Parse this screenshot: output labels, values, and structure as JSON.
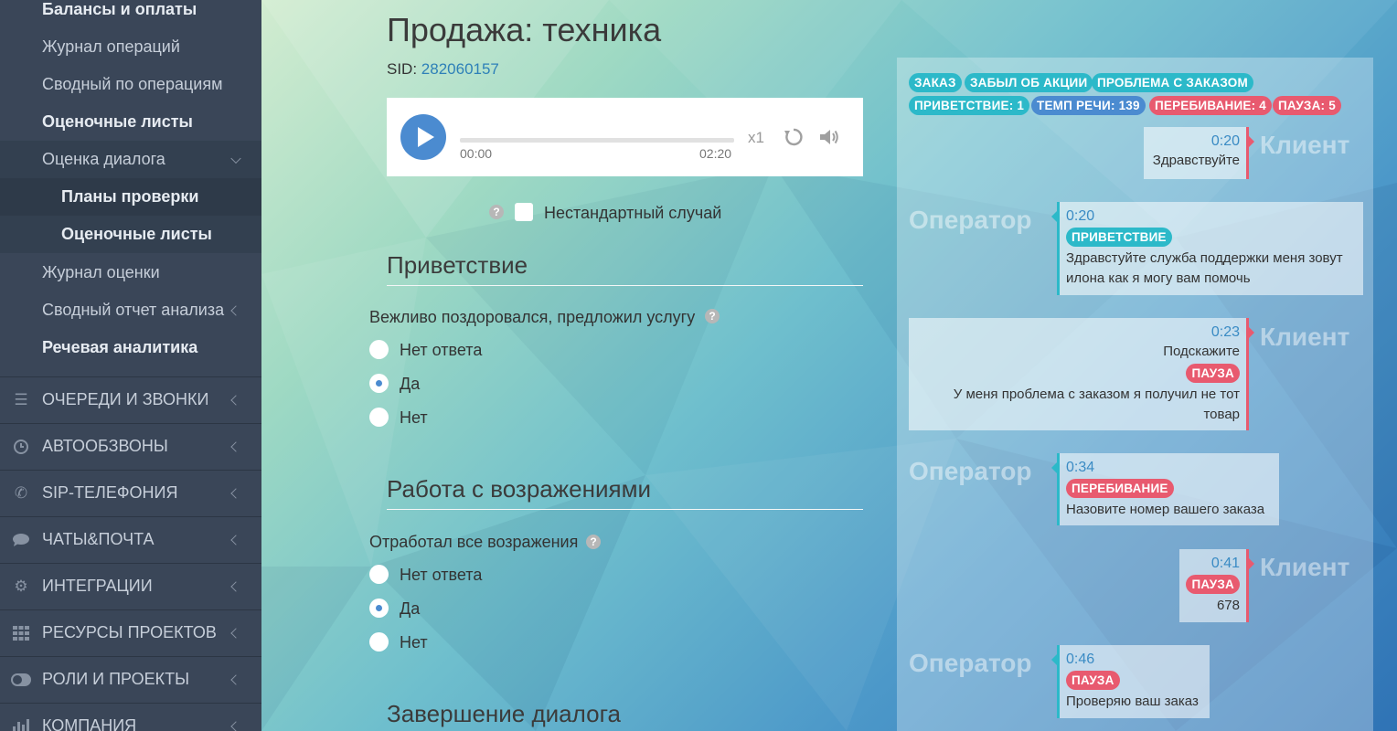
{
  "sidebar": {
    "items": [
      {
        "label": "Балансы и оплаты"
      },
      {
        "label": "Журнал операций"
      },
      {
        "label": "Сводный по операциям"
      },
      {
        "label": "Оценочные листы"
      },
      {
        "label": "Оценка диалога"
      },
      {
        "label": "Планы проверки"
      },
      {
        "label": "Оценочные листы"
      },
      {
        "label": "Журнал оценки"
      },
      {
        "label": "Сводный отчет анализа"
      },
      {
        "label": "Речевая аналитика"
      }
    ],
    "sections": [
      {
        "label": "ОЧЕРЕДИ И ЗВОНКИ",
        "icon": "list-icon"
      },
      {
        "label": "АВТООБЗВОНЫ",
        "icon": "clock-icon"
      },
      {
        "label": "SIP-ТЕЛЕФОНИЯ",
        "icon": "phone-icon"
      },
      {
        "label": "ЧАТЫ&ПОЧТА",
        "icon": "chat-icon"
      },
      {
        "label": "ИНТЕГРАЦИИ",
        "icon": "gears-icon"
      },
      {
        "label": "РЕСУРСЫ ПРОЕКТОВ",
        "icon": "grid-icon"
      },
      {
        "label": "РОЛИ И ПРОЕКТЫ",
        "icon": "toggle-icon"
      },
      {
        "label": "КОМПАНИЯ",
        "icon": "bar-chart-icon"
      }
    ]
  },
  "main": {
    "title": "Продажа: техника",
    "sid_label": "SID:",
    "sid_value": "282060157",
    "player": {
      "current": "00:00",
      "duration": "02:20",
      "speed": "x1",
      "progress": 0
    },
    "nonstandard_label": "Нестандартный случай",
    "sections": [
      {
        "title": "Приветствие",
        "question": "Вежливо поздоровался, предложил услугу",
        "options": [
          "Нет ответа",
          "Да",
          "Нет"
        ],
        "selected": 1
      },
      {
        "title": "Работа с возражениями",
        "question": "Отработал все возражения",
        "options": [
          "Нет ответа",
          "Да",
          "Нет"
        ],
        "selected": 1
      },
      {
        "title": "Завершение диалога"
      }
    ]
  },
  "panel": {
    "tags": [
      {
        "label": "ЗАКАЗ",
        "color": "#2cb9c9"
      },
      {
        "label": "ЗАБЫЛ ОБ АКЦИИ",
        "color": "#2cb9c9"
      },
      {
        "label": "ПРОБЛЕМА С ЗАКАЗОМ",
        "color": "#2cb9c9"
      },
      {
        "label": "ПРИВЕТСТВИЕ: 1",
        "color": "#2cb9c9"
      },
      {
        "label": "ТЕМП РЕЧИ: 139",
        "color": "#4b8bd0"
      },
      {
        "label": "ПЕРЕБИВАНИЕ: 4",
        "color": "#e85a6f"
      },
      {
        "label": "ПАУЗА: 5",
        "color": "#e85a6f"
      }
    ],
    "speakers": {
      "operator": "Оператор",
      "client": "Клиент"
    },
    "messages": [
      {
        "role": "client",
        "time": "0:20",
        "lines": [
          "Здравствуйте"
        ]
      },
      {
        "role": "operator",
        "time": "0:20",
        "tag": "ПРИВЕТСТВИЕ",
        "lines": [
          "Здравстуйте служба поддержки меня зовут",
          "илона как я могу вам помочь"
        ]
      },
      {
        "role": "client",
        "time": "0:23",
        "pre": "Подскажите",
        "tag": "ПАУЗА",
        "lines": [
          "У меня проблема с заказом я получил не тот",
          "товар"
        ]
      },
      {
        "role": "operator",
        "time": "0:34",
        "tag": "ПЕРЕБИВАНИЕ",
        "lines": [
          "Назовите номер вашего заказа"
        ]
      },
      {
        "role": "client",
        "time": "0:41",
        "tag": "ПАУЗА",
        "lines": [
          "678"
        ]
      },
      {
        "role": "operator",
        "time": "0:46",
        "tag": "ПАУЗА",
        "lines": [
          "Проверяю ваш заказ"
        ]
      }
    ]
  }
}
